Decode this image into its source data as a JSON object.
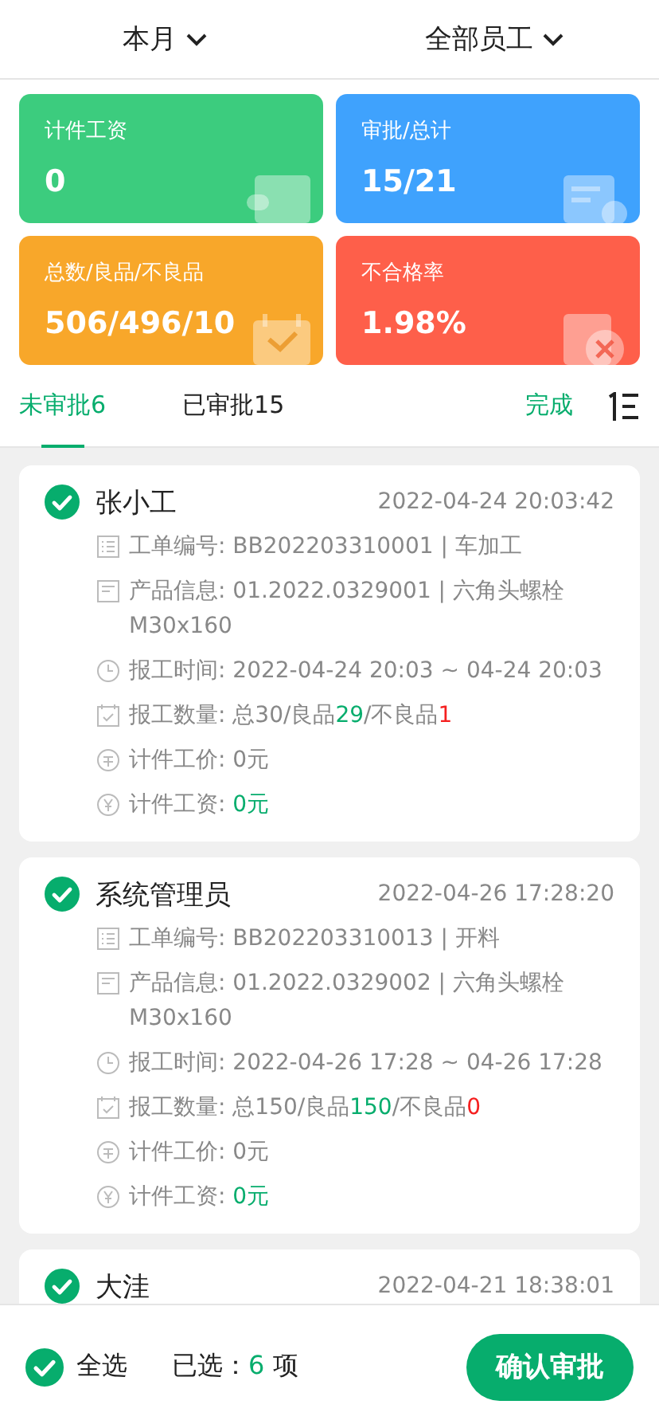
{
  "filters": [
    {
      "label": "本月"
    },
    {
      "label": "全部员工"
    }
  ],
  "stats": [
    {
      "label": "计件工资",
      "value": "0",
      "color": "#3ccc7e",
      "kind": "wallet"
    },
    {
      "label": "审批/总计",
      "value": "15/21",
      "color": "#3fa2fd",
      "kind": "document"
    },
    {
      "label": "总数/良品/不良品",
      "value": "506/496/10",
      "color": "#f8a72a",
      "kind": "calendar"
    },
    {
      "label": "不合格率",
      "value": "1.98%",
      "color": "#fe5f4a",
      "kind": "reject"
    }
  ],
  "tabs": [
    {
      "label": "未审批6",
      "selected": true
    },
    {
      "label": "已审批15",
      "selected": false
    }
  ],
  "done_link": "完成",
  "records": [
    {
      "name": "张小工",
      "time": "2022-04-24 20:03:42",
      "checked": true,
      "lines": [
        {
          "kind": "order",
          "segments": [
            {
              "text": "工单编号: BB202203310001 | 车加工",
              "color": "#888888"
            }
          ]
        },
        {
          "kind": "product",
          "segments": [
            {
              "text": "产品信息: 01.2022.0329001 | 六角头螺栓 M30x160",
              "color": "#888888"
            }
          ]
        },
        {
          "kind": "time",
          "segments": [
            {
              "text": "报工时间: 2022-04-24 20:03 ~ 04-24 20:03",
              "color": "#888888"
            }
          ]
        },
        {
          "kind": "quantity",
          "segments": [
            {
              "text": "报工数量: 总30/良品",
              "color": "#888888"
            },
            {
              "text": "29",
              "color": "#07ad6d"
            },
            {
              "text": "/不良品",
              "color": "#888888"
            },
            {
              "text": "1",
              "color": "#f52020"
            }
          ]
        },
        {
          "kind": "price",
          "segments": [
            {
              "text": "计件工价: 0元",
              "color": "#888888"
            }
          ]
        },
        {
          "kind": "wage",
          "segments": [
            {
              "text": "计件工资: ",
              "color": "#888888"
            },
            {
              "text": "0元",
              "color": "#07ad6d"
            }
          ]
        }
      ]
    },
    {
      "name": "系统管理员",
      "time": "2022-04-26 17:28:20",
      "checked": true,
      "lines": [
        {
          "kind": "order",
          "segments": [
            {
              "text": "工单编号: BB202203310013 | 开料",
              "color": "#888888"
            }
          ]
        },
        {
          "kind": "product",
          "segments": [
            {
              "text": "产品信息: 01.2022.0329002 | 六角头螺栓 M30x160",
              "color": "#888888"
            }
          ]
        },
        {
          "kind": "time",
          "segments": [
            {
              "text": "报工时间: 2022-04-26 17:28 ~ 04-26 17:28",
              "color": "#888888"
            }
          ]
        },
        {
          "kind": "quantity",
          "segments": [
            {
              "text": "报工数量: 总150/良品",
              "color": "#888888"
            },
            {
              "text": "150",
              "color": "#07ad6d"
            },
            {
              "text": "/不良品",
              "color": "#888888"
            },
            {
              "text": "0",
              "color": "#f52020"
            }
          ]
        },
        {
          "kind": "price",
          "segments": [
            {
              "text": "计件工价: 0元",
              "color": "#888888"
            }
          ]
        },
        {
          "kind": "wage",
          "segments": [
            {
              "text": "计件工资: ",
              "color": "#888888"
            },
            {
              "text": "0元",
              "color": "#07ad6d"
            }
          ]
        }
      ]
    },
    {
      "name": "大洼",
      "time": "2022-04-21 18:38:01",
      "checked": true
    }
  ],
  "footer": {
    "select_all": {
      "label": "全选",
      "checked": true
    },
    "selected_label": "已选：",
    "selected_count": "6",
    "selected_unit": "项",
    "confirm_button": "确认审批"
  }
}
